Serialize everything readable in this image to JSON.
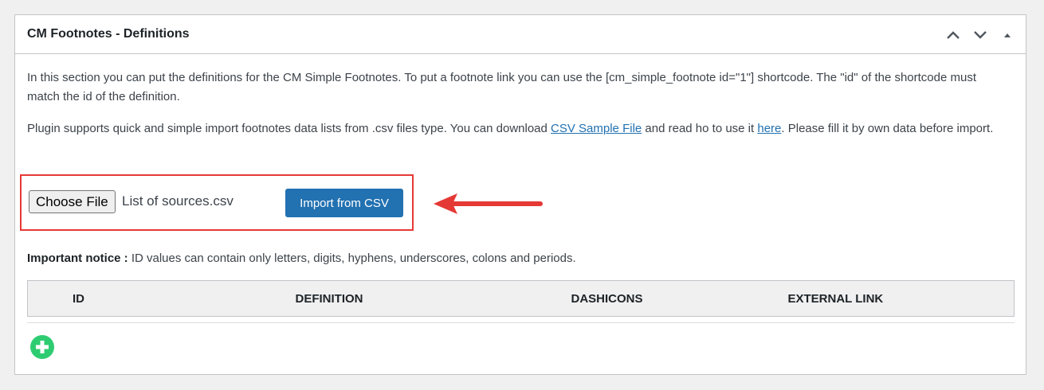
{
  "panel": {
    "title": "CM Footnotes - Definitions",
    "controls": [
      "chevron-up-icon",
      "chevron-down-icon",
      "triangle-up-icon"
    ]
  },
  "intro": {
    "text": "In this section you can put the definitions for the CM Simple Footnotes. To put a footnote link you can use the [cm_simple_footnote id=\"1\"] shortcode. The \"id\" of the shortcode must match the id of the definition."
  },
  "plugin_info": {
    "text_before": "Plugin supports quick and simple import footnotes data lists from .csv files type.  You can download ",
    "sample_link": "CSV Sample File",
    "text_middle": "  and read ho to use it ",
    "here_link": "here",
    "text_after": ".  Please fill it by own data before import."
  },
  "import": {
    "choose_label": "Choose File",
    "file_name": "List of sources.csv",
    "import_button": "Import from CSV"
  },
  "notice": {
    "label": "Important notice :",
    "text": " ID values can contain only letters, digits, hyphens, underscores, colons and periods."
  },
  "table": {
    "headers": [
      "ID",
      "DEFINITION",
      "DASHICONS",
      "EXTERNAL LINK"
    ]
  },
  "colors": {
    "accent": "#2271b1",
    "highlight": "#e53935",
    "add_button": "#2ecc71"
  }
}
